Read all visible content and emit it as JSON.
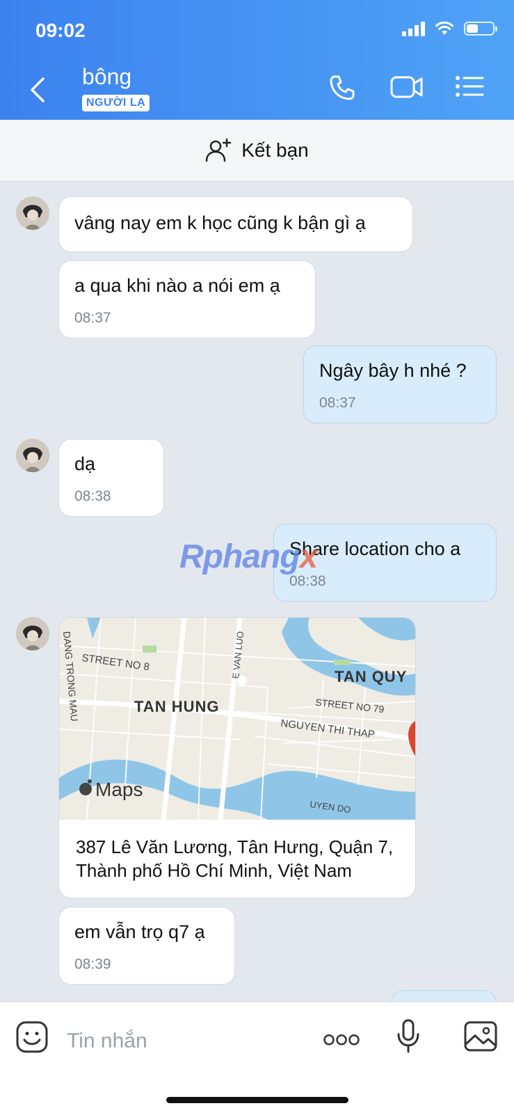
{
  "status_bar": {
    "time": "09:02"
  },
  "header": {
    "contact_name": "bông",
    "badge": "NGƯỜI LẠ"
  },
  "add_friend": {
    "label": "Kết bạn"
  },
  "messages": [
    {
      "side": "them",
      "text": "vâng nay em k học cũng k bận gì ạ"
    },
    {
      "side": "them",
      "text": "a qua khi nào a nói em ạ",
      "time": "08:37"
    },
    {
      "side": "me",
      "text": "Ngây bây h nhé ?",
      "time": "08:37"
    },
    {
      "side": "them",
      "text": "dạ",
      "time": "08:38"
    },
    {
      "side": "me",
      "text": "Share location cho a",
      "time": "08:38"
    },
    {
      "side": "them",
      "text": "em vẫn trọ q7 ạ",
      "time": "08:39"
    }
  ],
  "location": {
    "map_labels": {
      "tan_hung": "TAN HUNG",
      "tan_quy": "TAN QUY",
      "street_8": "STREET NO 8",
      "street_79": "STREET NO 79",
      "nguyen_thi_thap": "NGUYEN THI THAP",
      "dang_trong_mau": "DANG TRONG MAU",
      "le_van_luong": "E VAN LUO",
      "huyen_do": "UYEN DO",
      "maps_brand": "Maps"
    },
    "address": "387 Lê Văn Lương, Tân Hưng, Quận 7, Thành phố Hồ Chí Minh, Việt Nam"
  },
  "watermark": {
    "main": "Rphang",
    "accent": "x"
  },
  "composer": {
    "placeholder": "Tin nhắn"
  },
  "colors": {
    "header_start": "#3c82ef",
    "header_end": "#4fa3f6",
    "my_bubble": "#d8ecfb",
    "chat_bg": "#e3e8ee",
    "pin": "#d9452f"
  }
}
